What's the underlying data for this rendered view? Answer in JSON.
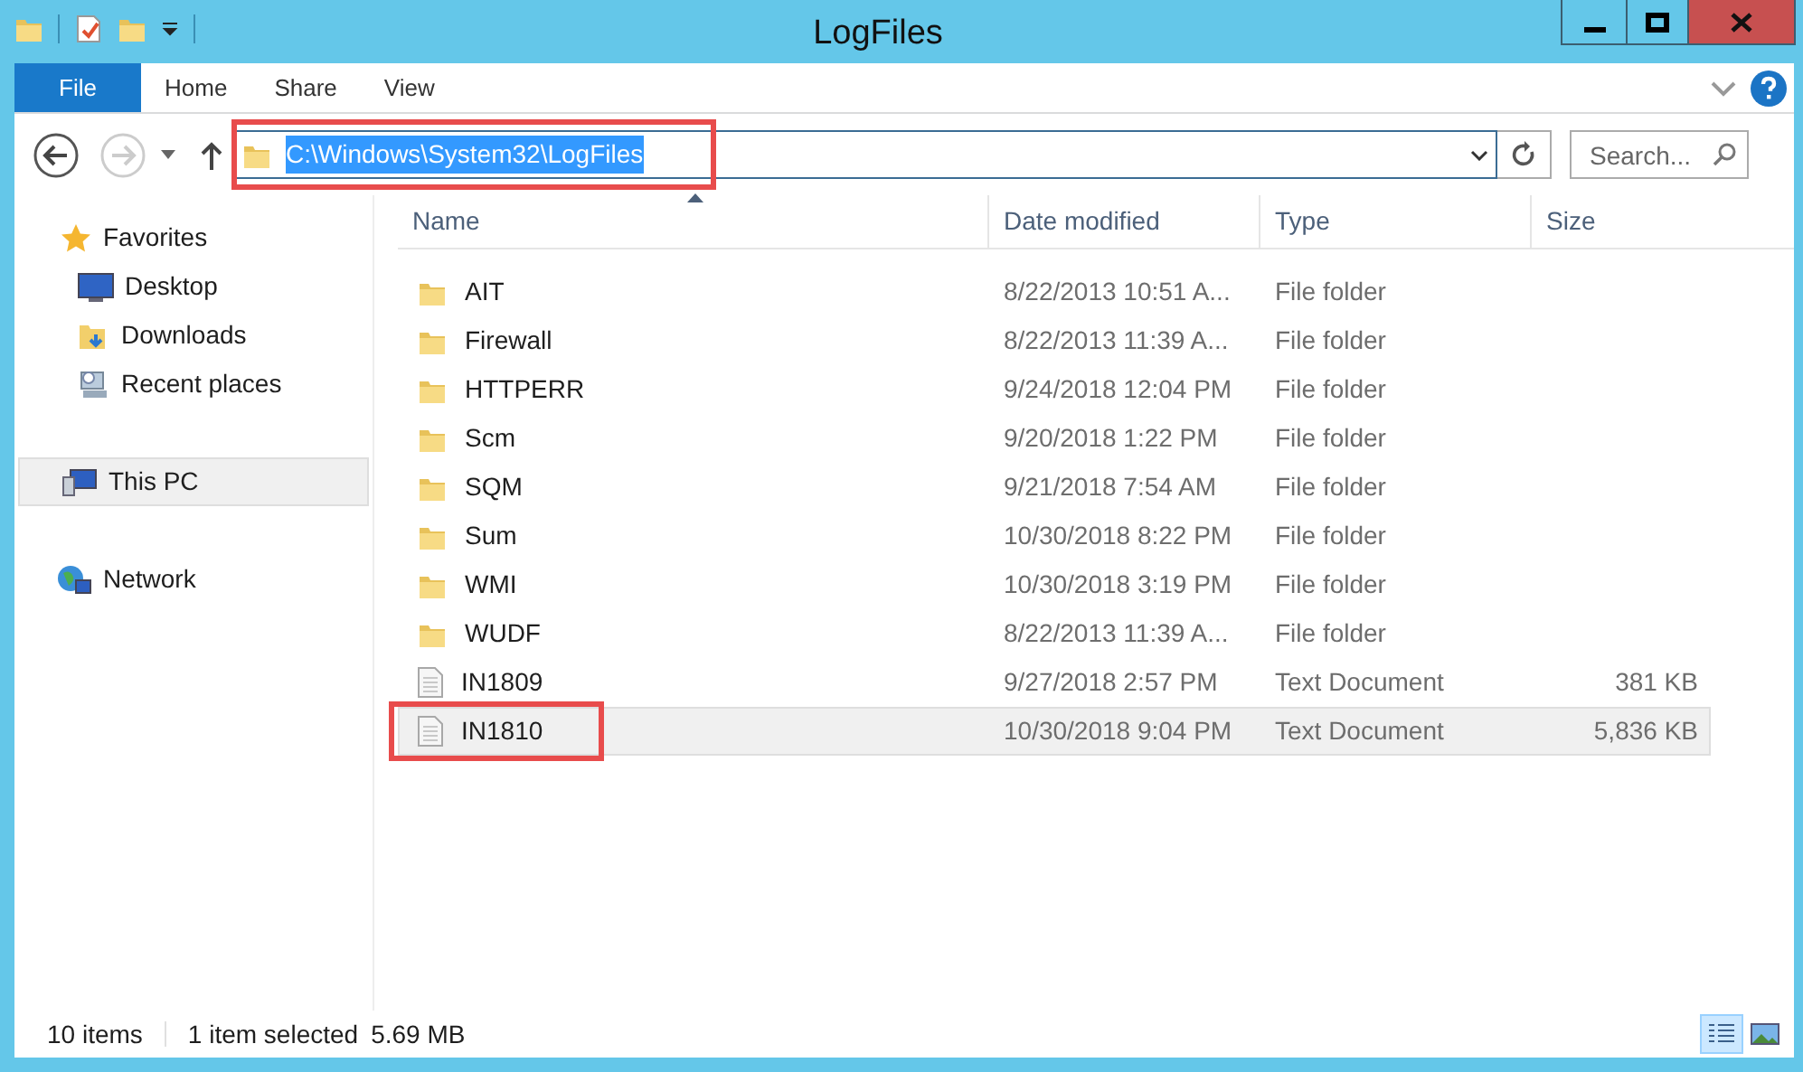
{
  "window": {
    "title": "LogFiles"
  },
  "ribbon_tabs": [
    {
      "label": "File",
      "kind": "file",
      "selected": false
    },
    {
      "label": "Home",
      "kind": "tab",
      "selected": false
    },
    {
      "label": "Share",
      "kind": "tab",
      "selected": false
    },
    {
      "label": "View",
      "kind": "tab",
      "selected": false
    }
  ],
  "address_bar": {
    "value": "C:\\Windows\\System32\\LogFiles",
    "text_selected": true,
    "highlighted": true
  },
  "search": {
    "placeholder": "Search..."
  },
  "nav_pane": [
    {
      "label": "Favorites",
      "kind": "favorites",
      "selected": false,
      "children": [
        {
          "label": "Desktop",
          "kind": "desktop",
          "selected": false
        },
        {
          "label": "Downloads",
          "kind": "downloads",
          "selected": false
        },
        {
          "label": "Recent places",
          "kind": "recent",
          "selected": false
        }
      ]
    },
    {
      "label": "This PC",
      "kind": "pc",
      "selected": true
    },
    {
      "label": "Network",
      "kind": "network",
      "selected": false
    }
  ],
  "table": {
    "columns": [
      "Name",
      "Date modified",
      "Type",
      "Size"
    ],
    "rows": [
      {
        "name": "AIT",
        "date": "8/22/2013 10:51 A...",
        "type": "File folder",
        "kind": "folder",
        "selected": false,
        "highlighted": false
      },
      {
        "name": "Firewall",
        "date": "8/22/2013 11:39 A...",
        "type": "File folder",
        "kind": "folder",
        "selected": false,
        "highlighted": false
      },
      {
        "name": "HTTPERR",
        "date": "9/24/2018 12:04 PM",
        "type": "File folder",
        "kind": "folder",
        "selected": false,
        "highlighted": false
      },
      {
        "name": "Scm",
        "date": "9/20/2018 1:22 PM",
        "type": "File folder",
        "kind": "folder",
        "selected": false,
        "highlighted": false
      },
      {
        "name": "SQM",
        "date": "9/21/2018 7:54 AM",
        "type": "File folder",
        "kind": "folder",
        "selected": false,
        "highlighted": false
      },
      {
        "name": "Sum",
        "date": "10/30/2018 8:22 PM",
        "type": "File folder",
        "kind": "folder",
        "selected": false,
        "highlighted": false
      },
      {
        "name": "WMI",
        "date": "10/30/2018 3:19 PM",
        "type": "File folder",
        "kind": "folder",
        "selected": false,
        "highlighted": false
      },
      {
        "name": "WUDF",
        "date": "8/22/2013 11:39 A...",
        "type": "File folder",
        "kind": "folder",
        "selected": false,
        "highlighted": false
      },
      {
        "name": "IN1809",
        "date": "9/27/2018 2:57 PM",
        "type": "Text Document",
        "size": "381 KB",
        "kind": "file",
        "selected": false,
        "highlighted": false
      },
      {
        "name": "IN1810",
        "date": "10/30/2018 9:04 PM",
        "type": "Text Document",
        "size": "5,836 KB",
        "kind": "file",
        "selected": true,
        "highlighted": true
      }
    ]
  },
  "status_bar": {
    "item_count": "10 items",
    "selection": "1 item selected",
    "selection_size": "5.69 MB"
  },
  "view_buttons": [
    {
      "kind": "details",
      "selected": true
    },
    {
      "kind": "thumbnails",
      "selected": false
    }
  ]
}
